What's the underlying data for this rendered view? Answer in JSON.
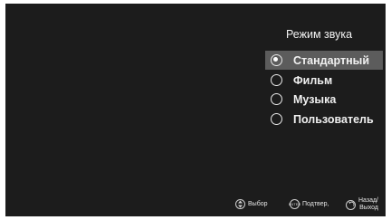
{
  "sound_menu": {
    "title": "Режим звука",
    "options": [
      {
        "label": "Стандартный",
        "selected": true
      },
      {
        "label": "Фильм",
        "selected": false
      },
      {
        "label": "Музыка",
        "selected": false
      },
      {
        "label": "Пользователь",
        "selected": false
      }
    ]
  },
  "hints": {
    "select": {
      "icon": "updown-icon",
      "label": "Выбор"
    },
    "confirm": {
      "icon": "enter-icon",
      "icon_text": "ENTER",
      "label": "Подтвер,"
    },
    "back": {
      "icon": "back-icon",
      "label_line1": "Назад/",
      "label_line2": "Выход"
    }
  }
}
